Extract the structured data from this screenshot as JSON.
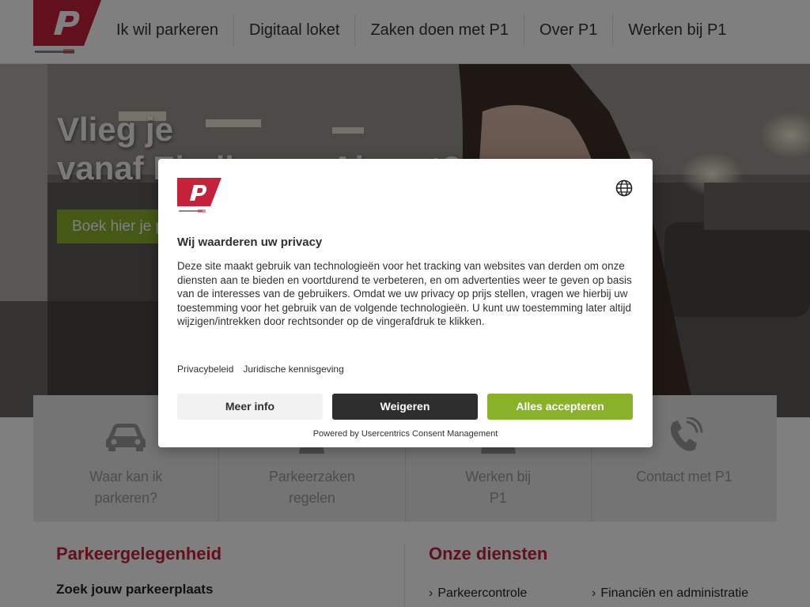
{
  "nav": {
    "items": [
      {
        "label": "Ik wil parkeren"
      },
      {
        "label": "Digitaal loket"
      },
      {
        "label": "Zaken doen met P1"
      },
      {
        "label": "Over P1"
      },
      {
        "label": "Werken bij P1"
      }
    ]
  },
  "hero": {
    "title_line1": "Vlieg je",
    "title_line2": "vanaf Eindhoven Airport?",
    "button": "Boek hier je parkeerplaats"
  },
  "quick_links": [
    {
      "label": "Waar kan ik\nparkeren?",
      "icon": "car-icon"
    },
    {
      "label": "Parkeerzaken\nregelen",
      "icon": "person-icon"
    },
    {
      "label": "Werken bij\nP1",
      "icon": "people-icon"
    },
    {
      "label": "Contact met P1",
      "icon": "phone-icon"
    }
  ],
  "content": {
    "left_title": "Parkeergelegenheid",
    "left_subtitle": "Zoek jouw parkeerplaats",
    "right_title": "Onze diensten",
    "services": [
      "Parkeercontrole",
      "Financiën en administratie"
    ]
  },
  "consent": {
    "title": "Wij waarderen uw privacy",
    "body": "Deze site maakt gebruik van technologieën voor het tracking van websites van derden om onze diensten aan te bieden en voortdurend te verbeteren, en om advertenties weer te geven op basis van de interesses van de gebruikers. Omdat we uw privacy op prijs stellen, vragen we hierbij uw toestemming voor het gebruik van de volgende technologieën. U kunt uw toestemming later altijd wijzigen/intrekken door rechtsonder op de vingerafdruk te klikken.",
    "link_privacy": "Privacybeleid",
    "link_legal": "Juridische kennisgeving",
    "btn_more": "Meer info",
    "btn_deny": "Weigeren",
    "btn_accept": "Alles accepteren",
    "powered_by": "Powered by Usercentrics Consent Management"
  },
  "colors": {
    "brand_red": "#c5213b",
    "accent_green": "#8ab12a",
    "dark_button": "#2e2e2e"
  }
}
